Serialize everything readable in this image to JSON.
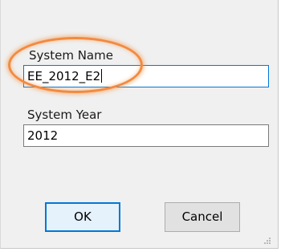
{
  "form": {
    "system_name": {
      "label": "System Name",
      "value": "EE_2012_E2"
    },
    "system_year": {
      "label": "System Year",
      "value": "2012"
    }
  },
  "buttons": {
    "ok_label": "OK",
    "cancel_label": "Cancel"
  },
  "colors": {
    "highlight": "#f28a40",
    "focus_border": "#0078d7",
    "dialog_background": "#f0f0f0"
  }
}
